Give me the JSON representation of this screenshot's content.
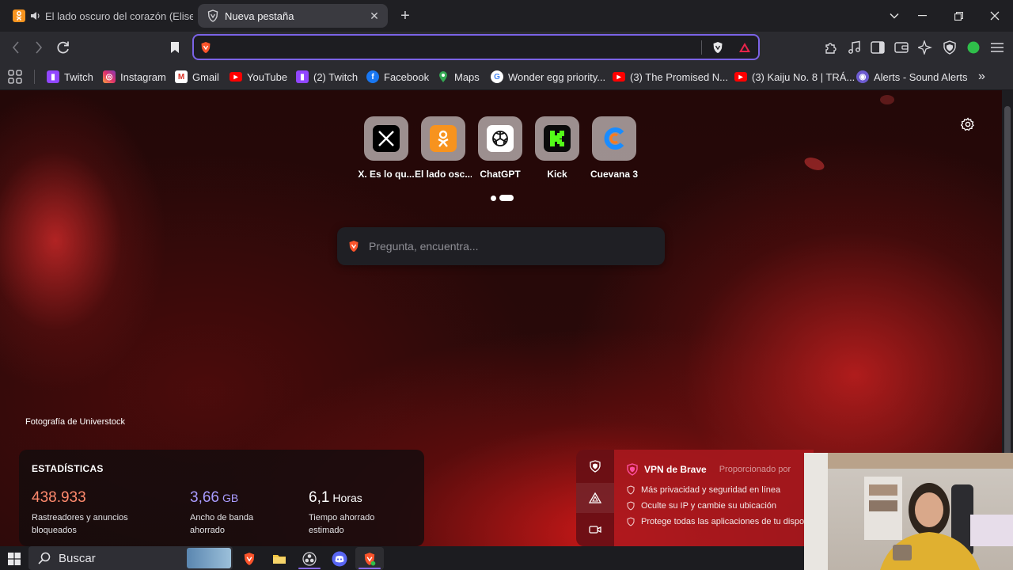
{
  "tabs": [
    {
      "title": "El lado oscuro del corazón (Eliseo"
    },
    {
      "title": "Nueva pestaña"
    }
  ],
  "bookmarks": [
    {
      "label": "Twitch",
      "icon": "twitch-icon"
    },
    {
      "label": "Instagram",
      "icon": "instagram-icon"
    },
    {
      "label": "Gmail",
      "icon": "gmail-icon"
    },
    {
      "label": "YouTube",
      "icon": "youtube-icon"
    },
    {
      "label": "(2) Twitch",
      "icon": "twitch-icon"
    },
    {
      "label": "Facebook",
      "icon": "facebook-icon"
    },
    {
      "label": "Maps",
      "icon": "maps-icon"
    },
    {
      "label": "Wonder egg priority...",
      "icon": "google-icon"
    },
    {
      "label": "(3) The Promised N...",
      "icon": "youtube-icon"
    },
    {
      "label": "(3) Kaiju No. 8 | TRÁ...",
      "icon": "youtube-icon"
    },
    {
      "label": "Alerts - Sound Alerts",
      "icon": "soundalerts-icon"
    }
  ],
  "top_sites": [
    {
      "label": "X. Es lo qu...",
      "icon": "x-icon"
    },
    {
      "label": "El lado osc...",
      "icon": "odnoklassniki-icon"
    },
    {
      "label": "ChatGPT",
      "icon": "chatgpt-icon"
    },
    {
      "label": "Kick",
      "icon": "kick-icon"
    },
    {
      "label": "Cuevana 3",
      "icon": "cuevana-icon"
    }
  ],
  "search": {
    "placeholder": "Pregunta, encuentra..."
  },
  "background_credit": "Fotografía de Universtock",
  "stats": {
    "title": "ESTADÍSTICAS",
    "trackers": {
      "value": "438.933",
      "desc1": "Rastreadores y anuncios",
      "desc2": "bloqueados"
    },
    "bandwidth": {
      "value": "3,66",
      "unit": "GB",
      "desc1": "Ancho de banda",
      "desc2": "ahorrado"
    },
    "time": {
      "value": "6,1",
      "unit": "Horas",
      "desc1": "Tiempo ahorrado",
      "desc2": "estimado"
    }
  },
  "vpn": {
    "title": "VPN de Brave",
    "provider": "Proporcionado por",
    "features": [
      "Más privacidad y seguridad en línea",
      "Oculte su IP y cambie su ubicación",
      "Protege todas las aplicaciones de tu dispo"
    ]
  },
  "taskbar": {
    "search_label": "Buscar"
  },
  "colors": {
    "accent": "#7b63e6",
    "trackers": "#ff8a6d",
    "bandwidth": "#a99cff",
    "brave": "#fb542b"
  }
}
